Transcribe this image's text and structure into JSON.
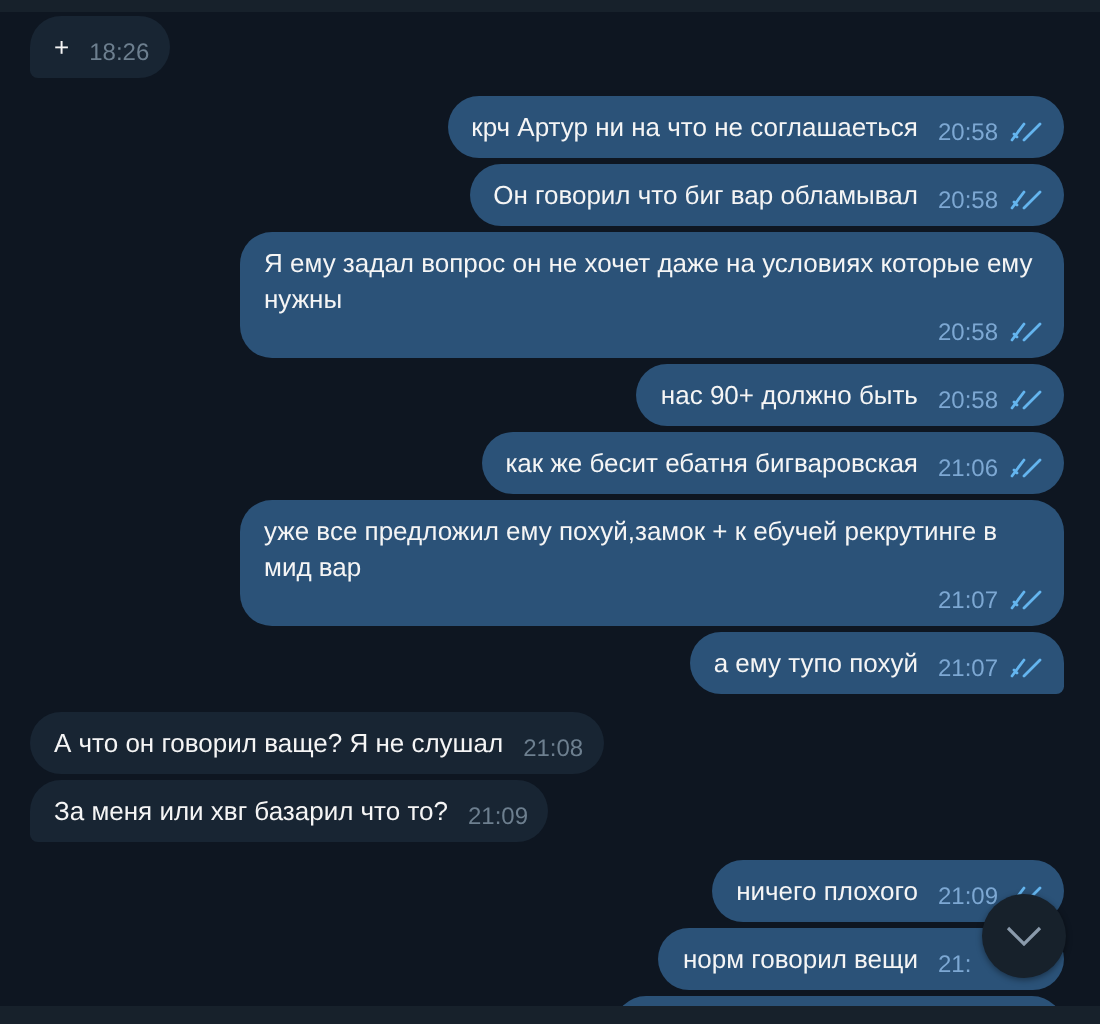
{
  "messages": [
    {
      "text": "+",
      "time": "18:26",
      "outgoing": false
    },
    {
      "text": "крч Артур ни на что не соглашаеться",
      "time": "20:58",
      "outgoing": true,
      "read": true
    },
    {
      "text": "Он говорил что биг вар обламывал",
      "time": "20:58",
      "outgoing": true,
      "read": true
    },
    {
      "text": "Я ему задал вопрос он не хочет даже на условиях которые ему нужны",
      "time": "20:58",
      "outgoing": true,
      "read": true
    },
    {
      "text": "нас 90+ должно быть",
      "time": "20:58",
      "outgoing": true,
      "read": true
    },
    {
      "text": "как же бесит ебатня бигваровская",
      "time": "21:06",
      "outgoing": true,
      "read": true
    },
    {
      "text": "уже все предложил ему похуй,замок + к ебучей рекрутинге в мид вар",
      "time": "21:07",
      "outgoing": true,
      "read": true
    },
    {
      "text": "а ему тупо похуй",
      "time": "21:07",
      "outgoing": true,
      "read": true
    },
    {
      "text": "А что он говорил ваще? Я не слушал",
      "time": "21:08",
      "outgoing": false
    },
    {
      "text": "За меня или хвг базарил что то?",
      "time": "21:09",
      "outgoing": false
    },
    {
      "text": "ничего плохого",
      "time": "21:09",
      "outgoing": true,
      "read": true
    },
    {
      "text": "норм говорил вещи",
      "time": "21:",
      "outgoing": true
    },
    {
      "kind": "partial",
      "outgoing": true
    }
  ]
}
